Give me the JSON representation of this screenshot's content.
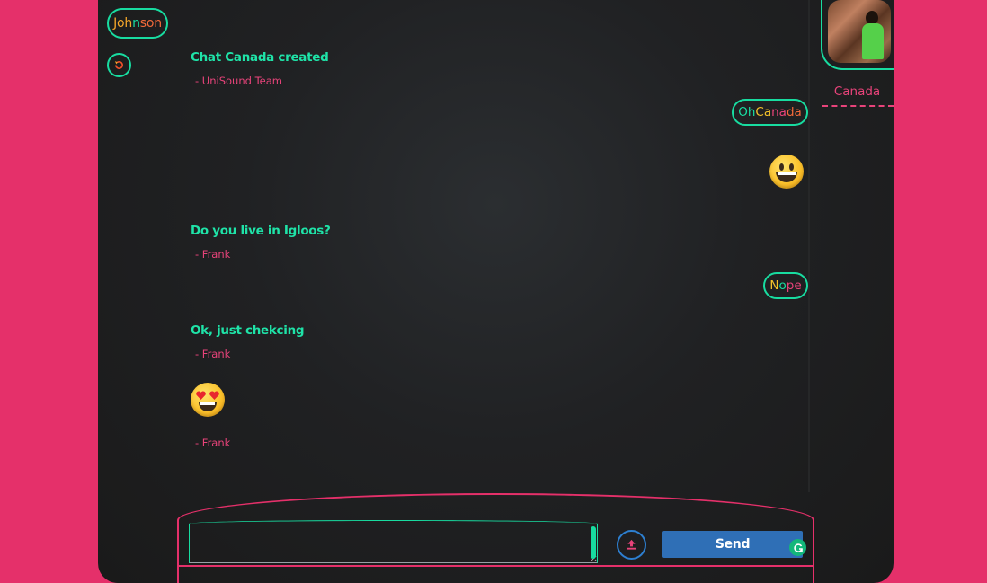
{
  "colors": {
    "accent_green": "#18dca0",
    "accent_pink": "#e8437a",
    "send_blue": "#2f6fb6"
  },
  "user": {
    "name_parts": [
      "Joh",
      "n",
      "son"
    ]
  },
  "contact": {
    "name": "Canada"
  },
  "messages": [
    {
      "type": "received",
      "text": "Chat Canada created",
      "author": "- UniSound Team"
    },
    {
      "type": "sent",
      "parts": [
        "Oh ",
        "Ca",
        "na",
        "da"
      ]
    },
    {
      "type": "sent_emoji",
      "emoji": "grinning-face"
    },
    {
      "type": "received",
      "text": "Do you live in Igloos?",
      "author": "- Frank"
    },
    {
      "type": "sent",
      "parts": [
        "N",
        "o",
        "pe"
      ]
    },
    {
      "type": "received",
      "text": "Ok, just chekcing",
      "author": "- Frank"
    },
    {
      "type": "received_emoji",
      "emoji": "heart-eyes-face",
      "author": "- Frank"
    }
  ],
  "composer": {
    "input_value": "",
    "send_label": "Send"
  }
}
